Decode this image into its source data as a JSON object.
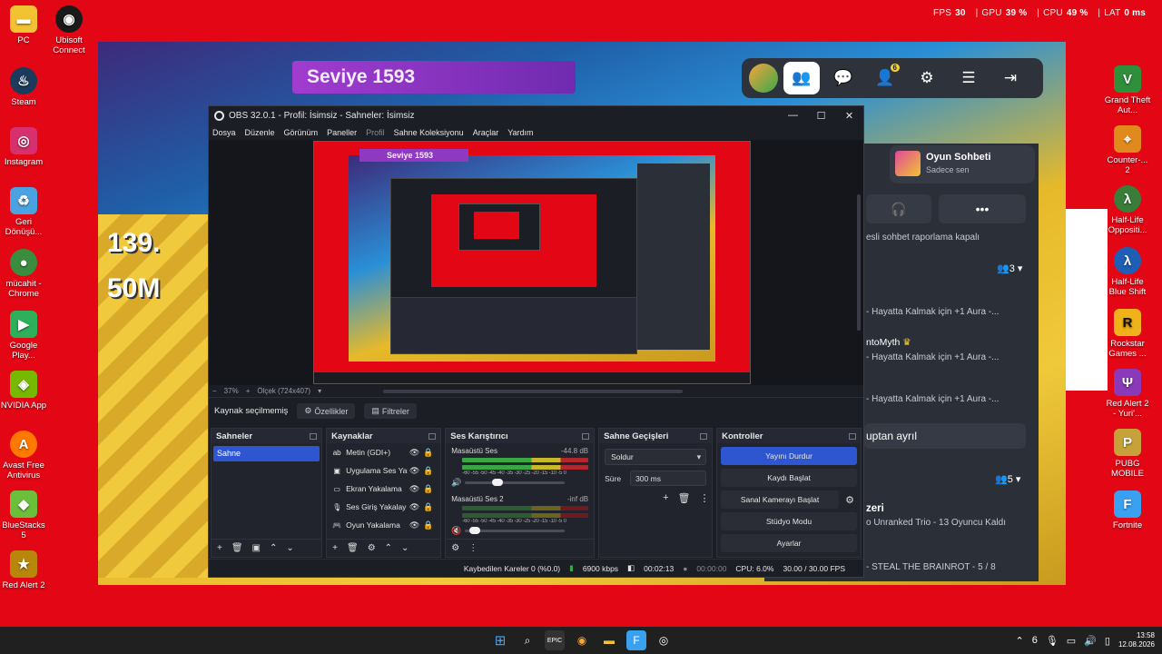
{
  "overlay": {
    "fps_label": "FPS",
    "fps_value": "30",
    "gpu_label": "GPU",
    "gpu_value": "39 %",
    "cpu_label": "CPU",
    "cpu_value": "49 %",
    "lat_label": "LAT",
    "lat_value": "0 ms"
  },
  "desktop_left": [
    {
      "label": "PC",
      "icon": "folder-icon",
      "color": "#f2c233"
    },
    {
      "label": "Ubisoft Connect",
      "icon": "ubisoft-icon",
      "color": "#1a1a1a"
    },
    {
      "label": "Steam",
      "icon": "steam-icon",
      "color": "#1b3a5c"
    },
    {
      "label": "Instagram",
      "icon": "instagram-icon",
      "color": "#d6306e"
    },
    {
      "label": "Geri Dönüşü...",
      "icon": "recycle-bin-icon",
      "color": "#4aa3e0"
    },
    {
      "label": "mücahit - Chrome",
      "icon": "chrome-icon",
      "color": "#3a8d3f"
    },
    {
      "label": "Google Play...",
      "icon": "google-play-icon",
      "color": "#2eaf5a"
    },
    {
      "label": "NVIDIA App",
      "icon": "nvidia-icon",
      "color": "#76b900"
    },
    {
      "label": "Avast Free Antivirus",
      "icon": "avast-icon",
      "color": "#ff7800"
    },
    {
      "label": "BlueStacks 5",
      "icon": "bluestacks-icon",
      "color": "#6bbf3a"
    },
    {
      "label": "Red Alert 2",
      "icon": "red-alert-icon",
      "color": "#b8860b"
    }
  ],
  "desktop_right": [
    {
      "label": "Grand Theft Aut...",
      "icon": "gta-icon",
      "color": "#2f8f3a"
    },
    {
      "label": "Counter-... 2",
      "icon": "cs2-icon",
      "color": "#e08a1e"
    },
    {
      "label": "Half-Life Oppositi...",
      "icon": "half-life-icon",
      "color": "#3a7d3a"
    },
    {
      "label": "Half-Life Blue Shift",
      "icon": "half-life-blue-icon",
      "color": "#1e5fb5"
    },
    {
      "label": "Rockstar Games ...",
      "icon": "rockstar-icon",
      "color": "#f0b21b"
    },
    {
      "label": "Red Alert 2 - Yuri'...",
      "icon": "yuri-icon",
      "color": "#8a3ab8"
    },
    {
      "label": "PUBG MOBILE",
      "icon": "pubg-icon",
      "color": "#c7a23b"
    },
    {
      "label": "Fortnite",
      "icon": "fortnite-icon",
      "color": "#3aa0f0"
    }
  ],
  "game": {
    "seviye": "Seviye 1593",
    "stat1": "139.",
    "stat2": "50M",
    "chat_title": "Oyun Sohbeti",
    "chat_sub": "Sadece sen",
    "report_text": "esli sohbet raporlama kapalı",
    "party_count_1": "3",
    "party_count_2": "5",
    "line1": "- Hayatta Kalmak için +1 Aura -...",
    "name2": "ntoMyth",
    "line2": "- Hayatta Kalmak için +1 Aura -...",
    "line3": "- Hayatta Kalmak için +1 Aura -...",
    "left_party": "uptan ayrıl",
    "friend_name": "zeri",
    "friend_status": "o Unranked Trio - 13 Oyuncu Kaldı",
    "friend_status2": "- STEAL THE BRAINROT - 5 / 8",
    "notif_count": "6"
  },
  "obs": {
    "title": "OBS 32.0.1 - Profil: İsimsiz - Sahneler: İsimsiz",
    "menu": [
      "Dosya",
      "Düzenle",
      "Görünüm",
      "Paneller",
      "Profil",
      "Sahne Koleksiyonu",
      "Araçlar",
      "Yardım"
    ],
    "zoom": "37%",
    "scale": "Ölçek (724x407)",
    "no_source": "Kaynak seçilmemiş",
    "properties": "Özellikler",
    "filters": "Filtreler",
    "docks": {
      "scenes": "Sahneler",
      "sources": "Kaynaklar",
      "mixer": "Ses Karıştırıcı",
      "transitions": "Sahne Geçişleri",
      "controls": "Kontroller"
    },
    "scenes": [
      "Sahne"
    ],
    "sources": [
      {
        "name": "Metin (GDI+)",
        "icon": "text-icon"
      },
      {
        "name": "Uygulama Ses Yal",
        "icon": "app-audio-icon"
      },
      {
        "name": "Ekran Yakalama",
        "icon": "display-icon"
      },
      {
        "name": "Ses Giriş Yakalay",
        "icon": "mic-icon"
      },
      {
        "name": "Oyun Yakalama",
        "icon": "gamepad-icon"
      }
    ],
    "mixer": [
      {
        "name": "Masaüstü Ses",
        "db": "-44.8 dB",
        "vol": 0.3,
        "muted": false
      },
      {
        "name": "Masaüstü Ses 2",
        "db": "-inf dB",
        "vol": 0.05,
        "muted": true
      }
    ],
    "meter_ticks": "-60 -55 -50 -45 -40 -35 -30 -25 -20 -15 -10 -5 0",
    "transition": "Soldur",
    "duration_label": "Süre",
    "duration_value": "300 ms",
    "controls": {
      "stop_stream": "Yayını Durdur",
      "start_record": "Kaydı Başlat",
      "virtual_cam": "Sanal Kamerayı Başlat",
      "studio_mode": "Stüdyo Modu",
      "settings": "Ayarlar"
    },
    "status": {
      "dropped": "Kaybedilen Kareler 0 (%0.0)",
      "bitrate": "6900 kbps",
      "stream_time": "00:02:13",
      "record_time": "00:00:00",
      "cpu": "CPU: 6.0%",
      "fps": "30.00 / 30.00 FPS"
    }
  },
  "taskbar": {
    "time": "13:58",
    "date": "12.08.2026",
    "tray_num": "6"
  }
}
